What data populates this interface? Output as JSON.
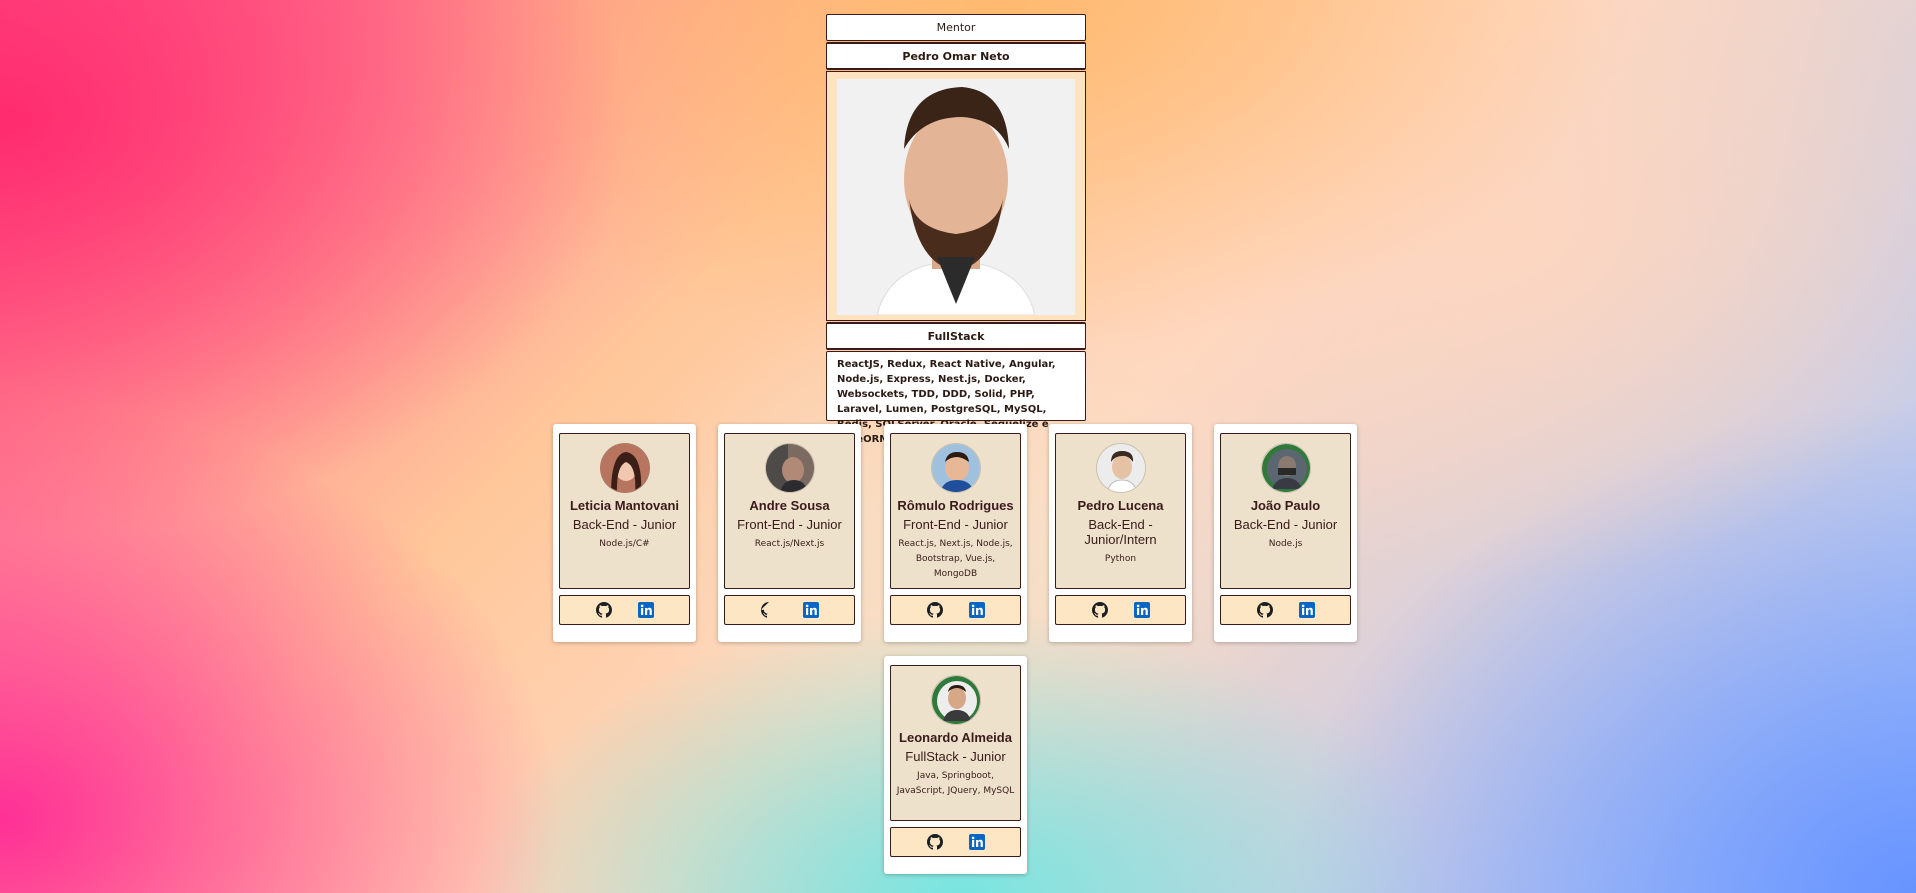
{
  "mentor": {
    "label": "Mentor",
    "name": "Pedro Omar Neto",
    "stack": "FullStack",
    "techs": "ReactJS, Redux, React Native, Angular, Node.js, Express, Nest.js, Docker, Websockets, TDD, DDD, Solid, PHP, Laravel, Lumen, PostgreSQL, MySQL, Redis, SQLServer, Oracle, Sequelize e TypeORM"
  },
  "members": [
    {
      "name": "Leticia Mantovani",
      "role": "Back-End - Junior",
      "techs": "Node.js/C#"
    },
    {
      "name": "Andre Sousa",
      "role": "Front-End - Junior",
      "techs": "React.js/Next.js"
    },
    {
      "name": "Rômulo Rodrigues",
      "role": "Front-End - Junior",
      "techs": "React.js, Next.js, Node.js, Bootstrap, Vue.js, MongoDB"
    },
    {
      "name": "Pedro Lucena",
      "role": "Back-End - Junior/Intern",
      "techs": "Python"
    },
    {
      "name": "João Paulo",
      "role": "Back-End - Junior",
      "techs": "Node.js"
    },
    {
      "name": "Leonardo Almeida",
      "role": "FullStack - Junior",
      "techs": "Java, Springboot, JavaScript, JQuery, MySQL"
    }
  ],
  "icons": {
    "github": "github-icon",
    "linkedin": "linkedin-icon"
  },
  "colors": {
    "linkedin": "#0a66c2",
    "github": "#1b1f23",
    "card_bg": "#ede1cc",
    "links_bg": "#fde6c4"
  }
}
